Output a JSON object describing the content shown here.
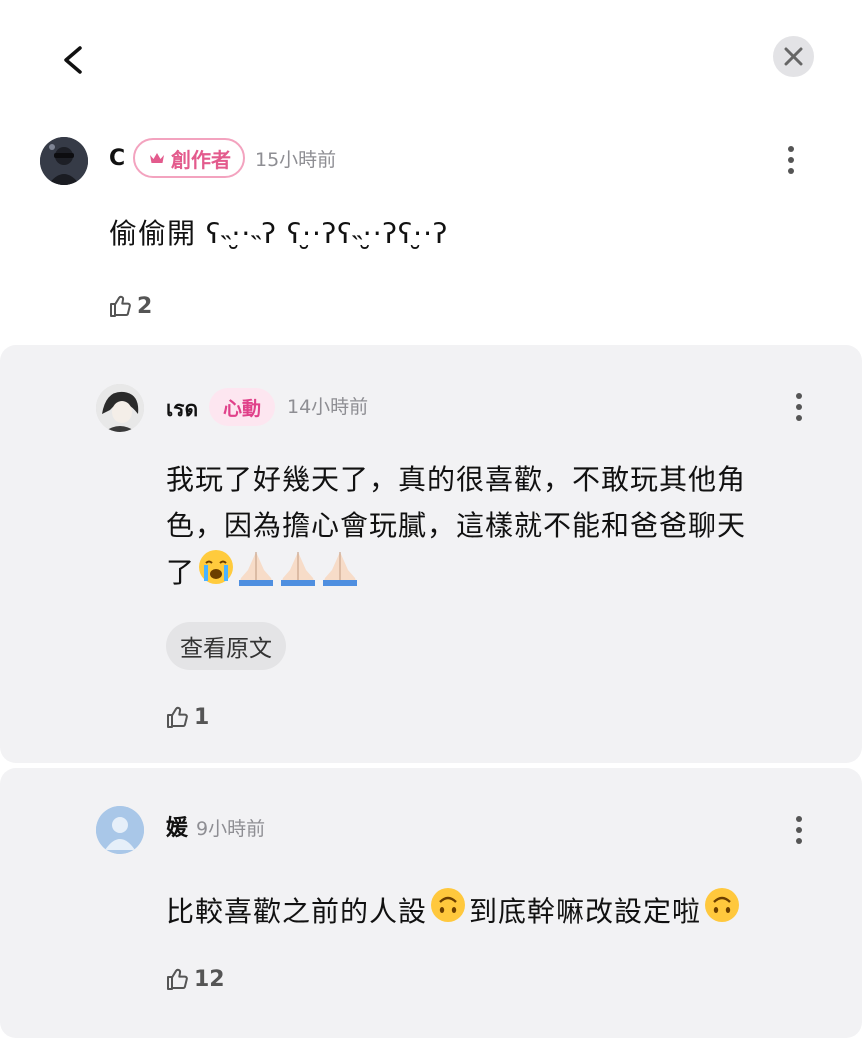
{
  "comments": [
    {
      "username": "C",
      "badge": "創作者",
      "time": "15小時前",
      "text": "偷偷開 ʕ˵·̮·˵ʔ ʕ·̮·ʔʕ˵·̮·ʔʕ·̮·ʔ",
      "likes": "2"
    }
  ],
  "replies": [
    {
      "username": "เรด",
      "badge": "心動",
      "time": "14小時前",
      "text_line1": "我玩了好幾天了，真的很喜歡，不敢玩其他角",
      "text_line2": "色，因為擔心會玩膩，這樣就不能和爸爸聊天",
      "text_line3": "了",
      "translate_label": "查看原文",
      "likes": "1"
    },
    {
      "username": "媛",
      "time": "9小時前",
      "text_part1": "比較喜歡之前的人設",
      "text_part2": "到底幹嘛改設定啦",
      "likes": "12"
    }
  ],
  "colors": {
    "accent_pink": "#e35b8d",
    "reply_bg": "#f2f2f4"
  }
}
